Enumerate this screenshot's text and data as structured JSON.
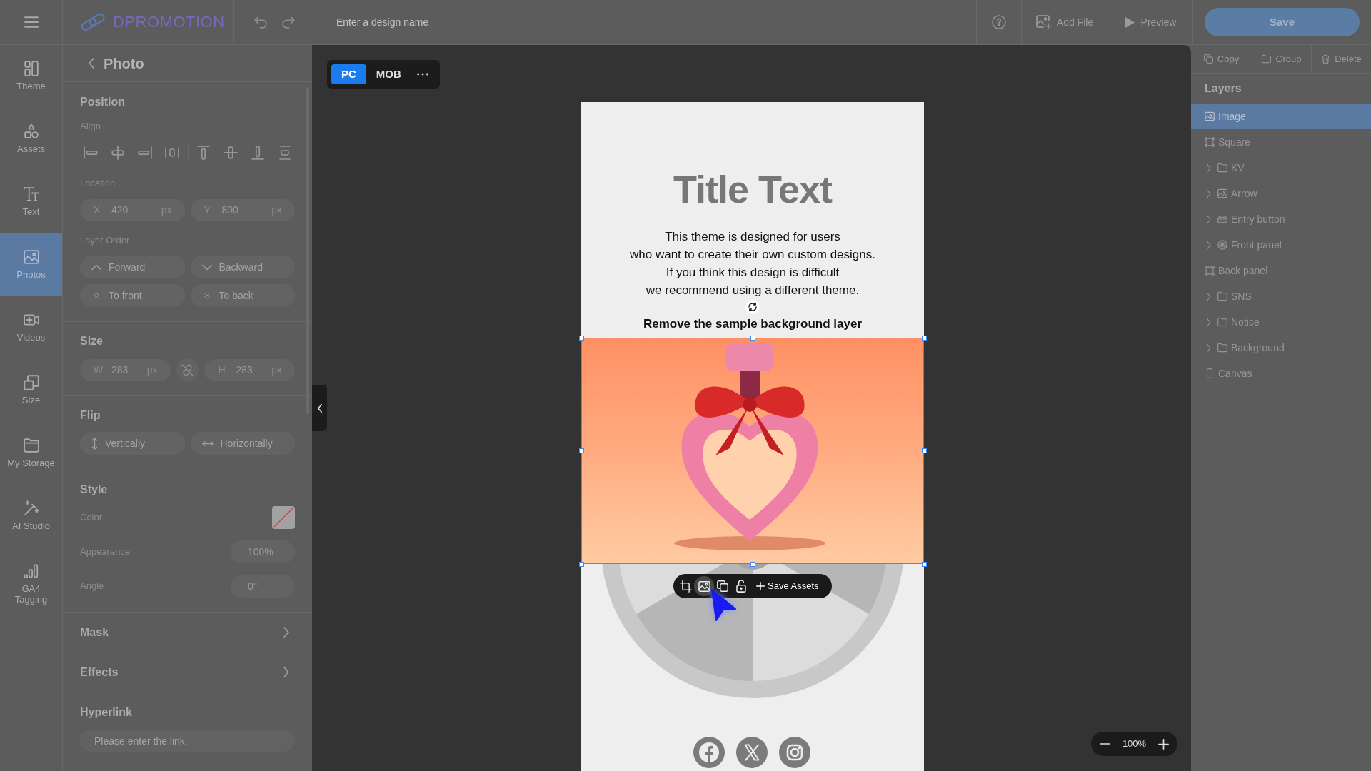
{
  "top_bar": {
    "logo": "DPROMOTION",
    "design_name": {
      "placeholder": "Enter a design name"
    },
    "add_file": "Add File",
    "preview": "Preview",
    "save": "Save"
  },
  "sidebar": {
    "items": [
      {
        "label": "Theme",
        "kind": "theme",
        "selected": false
      },
      {
        "label": "Assets",
        "kind": "assets",
        "selected": false
      },
      {
        "label": "Text",
        "kind": "text",
        "selected": false
      },
      {
        "label": "Photos",
        "kind": "photos",
        "selected": true
      },
      {
        "label": "Videos",
        "kind": "videos",
        "selected": false
      },
      {
        "label": "Size",
        "kind": "size",
        "selected": false
      },
      {
        "label": "My Storage",
        "kind": "storage",
        "selected": false
      },
      {
        "label": "AI Studio",
        "kind": "ai",
        "selected": false
      },
      {
        "label": "GA4 Tagging",
        "kind": "analytics",
        "selected": false
      }
    ]
  },
  "panel": {
    "title": "Photo",
    "position": {
      "heading": "Position",
      "align_label": "Align",
      "location_label": "Location",
      "x": {
        "label": "X",
        "value": "420",
        "unit": "px"
      },
      "y": {
        "label": "Y",
        "value": "800",
        "unit": "px"
      },
      "order_label": "Layer Order",
      "order_buttons": [
        {
          "label": "Forward",
          "kind": "up"
        },
        {
          "label": "Backward",
          "kind": "down"
        },
        {
          "label": "To front",
          "kind": "top"
        },
        {
          "label": "To back",
          "kind": "bottom"
        }
      ]
    },
    "size": {
      "heading": "Size",
      "w": {
        "label": "W",
        "value": "283",
        "unit": "px"
      },
      "h": {
        "label": "H",
        "value": "283",
        "unit": "px"
      },
      "ratio_locked": false
    },
    "flip": {
      "heading": "Flip",
      "buttons": [
        {
          "label": "Vertically",
          "kind": "vertical"
        },
        {
          "label": "Horizontally",
          "kind": "horizontal"
        }
      ]
    },
    "style": {
      "heading": "Style",
      "rows": [
        {
          "kind": "color",
          "label": "Color"
        },
        {
          "kind": "value",
          "label": "Appearance",
          "value": "100%"
        },
        {
          "kind": "value",
          "label": "Angle",
          "value": "0°"
        }
      ]
    },
    "toggles": [
      {
        "label": "Mask",
        "expanded": false
      },
      {
        "label": "Effects",
        "expanded": false
      }
    ],
    "hyperlink": {
      "heading": "Hyperlink",
      "placeholder": "Please enter the link."
    }
  },
  "canvas": {
    "device_tabs": [
      {
        "label": "PC",
        "selected": true
      },
      {
        "label": "MOB",
        "selected": false
      }
    ],
    "design": {
      "title": "Title Text",
      "body": [
        "This theme is designed for users",
        "who want to create their own custom designs.",
        "If you think this design is difficult",
        "we recommend using a different theme."
      ],
      "notice": "Remove the sample background layer",
      "image": {
        "selected": true
      },
      "toolbar": {
        "save_label": "Save Assets"
      }
    },
    "zoom": "100%"
  },
  "layers_panel": {
    "actions": [
      {
        "label": "Copy",
        "kind": "copy"
      },
      {
        "label": "Group",
        "kind": "group"
      },
      {
        "label": "Delete",
        "kind": "delete"
      }
    ],
    "title": "Layers",
    "items": [
      {
        "label": "Image",
        "kind": "image",
        "selected": true
      },
      {
        "label": "Square",
        "kind": "shape",
        "selected": false
      },
      {
        "label": "KV",
        "kind": "folder",
        "expanded": false,
        "selected": false
      },
      {
        "label": "Arrow",
        "kind": "image",
        "expanded": false,
        "selected": false
      },
      {
        "label": "Entry button",
        "kind": "button",
        "expanded": false,
        "selected": false
      },
      {
        "label": "Front panel",
        "kind": "wheel",
        "expanded": false,
        "selected": false
      },
      {
        "label": "Back panel",
        "kind": "shape",
        "selected": false
      },
      {
        "label": "SNS",
        "kind": "folder",
        "expanded": false,
        "selected": false
      },
      {
        "label": "Notice",
        "kind": "folder",
        "expanded": false,
        "selected": false
      },
      {
        "label": "Background",
        "kind": "folder",
        "expanded": false,
        "selected": false
      },
      {
        "label": "Canvas",
        "kind": "canvas",
        "selected": false
      }
    ]
  }
}
